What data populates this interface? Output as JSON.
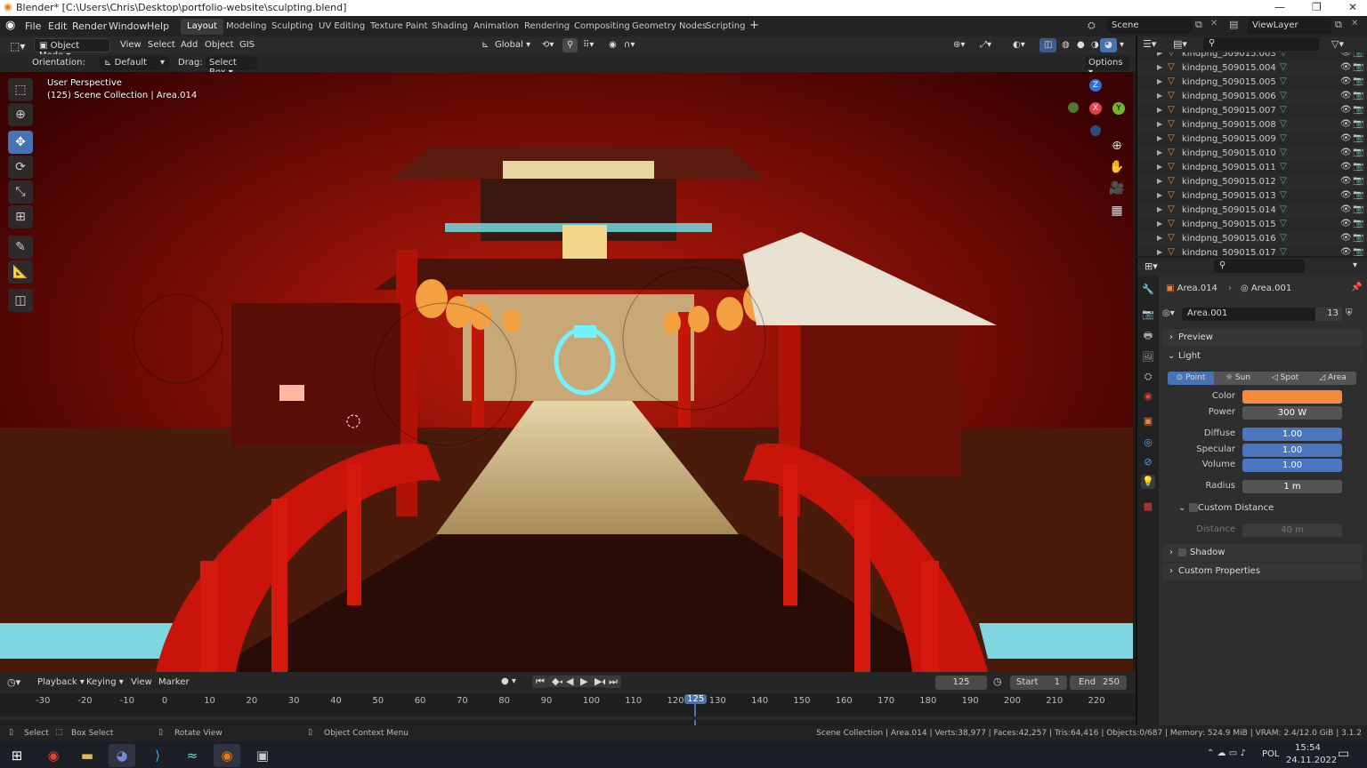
{
  "window": {
    "title": "Blender* [C:\\Users\\Chris\\Desktop\\portfolio-website\\sculpting.blend]",
    "min": "—",
    "max": "❐",
    "close": "✕"
  },
  "menu": [
    "File",
    "Edit",
    "Render",
    "Window",
    "Help"
  ],
  "workspaces": [
    "Layout",
    "Modeling",
    "Sculpting",
    "UV Editing",
    "Texture Paint",
    "Shading",
    "Animation",
    "Rendering",
    "Compositing",
    "Geometry Nodes",
    "Scripting"
  ],
  "scene": {
    "name": "Scene",
    "view_layer": "ViewLayer"
  },
  "viewport_header": {
    "mode": "Object Mode",
    "menus": [
      "View",
      "Select",
      "Add",
      "Object",
      "GIS"
    ],
    "orientation_global": "Global"
  },
  "tool_header": {
    "orientation_label": "Orientation:",
    "orientation_value": "Default",
    "drag_label": "Drag:",
    "drag_value": "Select Box",
    "options": "Options"
  },
  "viewport": {
    "perspective": "User Perspective",
    "collection": "(125) Scene Collection | Area.014"
  },
  "gizmo": {
    "x": "X",
    "y": "Y",
    "z": "Z"
  },
  "outliner": {
    "rows": [
      "kindpng_509015.003",
      "kindpng_509015.004",
      "kindpng_509015.005",
      "kindpng_509015.006",
      "kindpng_509015.007",
      "kindpng_509015.008",
      "kindpng_509015.009",
      "kindpng_509015.010",
      "kindpng_509015.011",
      "kindpng_509015.012",
      "kindpng_509015.013",
      "kindpng_509015.014",
      "kindpng_509015.015",
      "kindpng_509015.016",
      "kindpng_509015.017"
    ]
  },
  "properties": {
    "breadcrumb_obj": "Area.014",
    "breadcrumb_data": "Area.001",
    "datablock": "Area.001",
    "users": "13",
    "preview": "Preview",
    "light": "Light",
    "types": [
      "Point",
      "Sun",
      "Spot",
      "Area"
    ],
    "color_label": "Color",
    "color_value": "#f58b3c",
    "power_label": "Power",
    "power_value": "300 W",
    "diffuse_label": "Diffuse",
    "diffuse_value": "1.00",
    "specular_label": "Specular",
    "specular_value": "1.00",
    "volume_label": "Volume",
    "volume_value": "1.00",
    "radius_label": "Radius",
    "radius_value": "1 m",
    "custom_distance": "Custom Distance",
    "distance_label": "Distance",
    "distance_value": "40 m",
    "shadow": "Shadow",
    "custom_properties": "Custom Properties"
  },
  "timeline": {
    "menus": [
      "Playback",
      "Keying",
      "View",
      "Marker"
    ],
    "current": "125",
    "start_label": "Start",
    "start": "1",
    "end_label": "End",
    "end": "250",
    "frames": [
      "-30",
      "-20",
      "-10",
      "0",
      "10",
      "20",
      "30",
      "40",
      "50",
      "60",
      "70",
      "80",
      "90",
      "100",
      "110",
      "120",
      "125",
      "130",
      "140",
      "150",
      "160",
      "170",
      "180",
      "190",
      "200",
      "210",
      "220"
    ]
  },
  "status": {
    "select": "Select",
    "box_select": "Box Select",
    "rotate": "Rotate View",
    "context": "Object Context Menu",
    "stats": "Scene Collection | Area.014 | Verts:38,977 | Faces:42,257 | Tris:64,416 | Objects:0/687 | Memory: 524.9 MiB | VRAM: 2.4/12.0 GiB | 3.1.2"
  },
  "taskbar": {
    "lang": "POL",
    "time": "15:54",
    "date": "24.11.2022"
  }
}
